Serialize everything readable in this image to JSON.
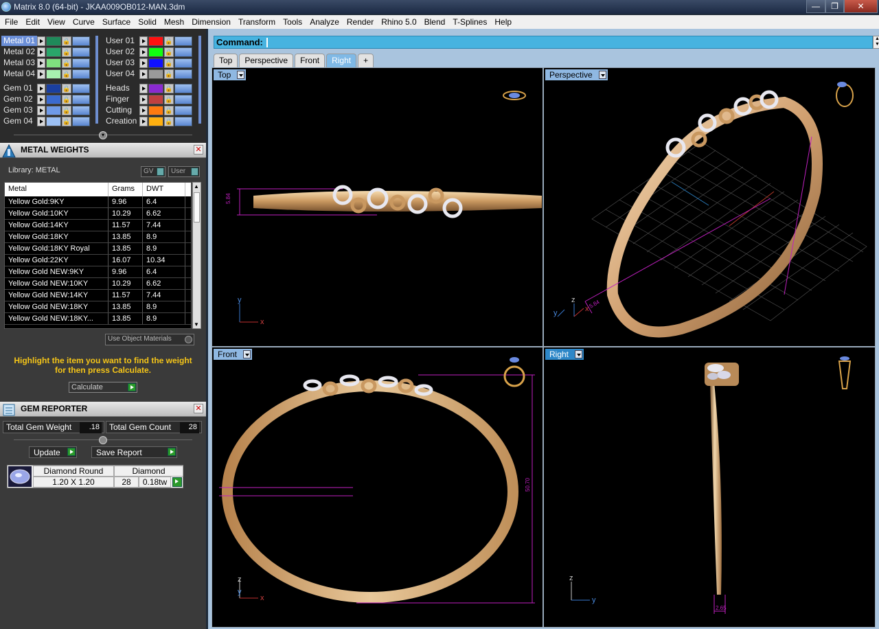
{
  "window": {
    "title": "Matrix 8.0 (64-bit) - JKAA009OB012-MAN.3dm",
    "minimize": "—",
    "restore": "❐",
    "close": "✕"
  },
  "menu": [
    "File",
    "Edit",
    "View",
    "Curve",
    "Surface",
    "Solid",
    "Mesh",
    "Dimension",
    "Transform",
    "Tools",
    "Analyze",
    "Render",
    "Rhino 5.0",
    "Blend",
    "T-Splines",
    "Help"
  ],
  "layers": {
    "left": [
      {
        "name": "Metal 01",
        "color": "#1f8a5a",
        "selected": true
      },
      {
        "name": "Metal 02",
        "color": "#2aa66a"
      },
      {
        "name": "Metal 03",
        "color": "#7fe07f"
      },
      {
        "name": "Metal 04",
        "color": "#a8f0b0"
      },
      {
        "name": "Gem 01",
        "color": "#1a3fa0"
      },
      {
        "name": "Gem 02",
        "color": "#3a6ad0"
      },
      {
        "name": "Gem 03",
        "color": "#6f9ae8"
      },
      {
        "name": "Gem 04",
        "color": "#9cc0f4"
      }
    ],
    "right": [
      {
        "name": "User 01",
        "color": "#ff1010"
      },
      {
        "name": "User 02",
        "color": "#10ff10"
      },
      {
        "name": "User 03",
        "color": "#1010ff"
      },
      {
        "name": "User 04",
        "color": "#9a9a9a"
      },
      {
        "name": "Heads",
        "color": "#8a2ad0"
      },
      {
        "name": "Finger",
        "color": "#c04040"
      },
      {
        "name": "Cutting",
        "color": "#ff7a10"
      },
      {
        "name": "Creation",
        "color": "#ffb010"
      }
    ]
  },
  "metal_weights": {
    "title": "METAL WEIGHTS",
    "library": "Library: METAL",
    "gv_label": "GV",
    "user_label": "User",
    "columns": [
      "Metal",
      "Grams",
      "DWT"
    ],
    "rows": [
      [
        "Yellow Gold:9KY",
        "9.96",
        "6.4"
      ],
      [
        "Yellow Gold:10KY",
        "10.29",
        "6.62"
      ],
      [
        "Yellow Gold:14KY",
        "11.57",
        "7.44"
      ],
      [
        "Yellow Gold:18KY",
        "13.85",
        "8.9"
      ],
      [
        "Yellow Gold:18KY Royal",
        "13.85",
        "8.9"
      ],
      [
        "Yellow Gold:22KY",
        "16.07",
        "10.34"
      ],
      [
        "Yellow Gold NEW:9KY",
        "9.96",
        "6.4"
      ],
      [
        "Yellow Gold NEW:10KY",
        "10.29",
        "6.62"
      ],
      [
        "Yellow Gold NEW:14KY",
        "11.57",
        "7.44"
      ],
      [
        "Yellow Gold NEW:18KY",
        "13.85",
        "8.9"
      ],
      [
        "Yellow Gold NEW:18KY...",
        "13.85",
        "8.9"
      ]
    ],
    "use_object_materials": "Use Object Materials",
    "hint": "Highlight the item you want to find the weight for then press Calculate.",
    "calculate": "Calculate"
  },
  "gem_reporter": {
    "title": "GEM REPORTER",
    "total_weight_label": "Total Gem Weight",
    "total_weight": ".18",
    "total_count_label": "Total Gem Count",
    "total_count": "28",
    "update": "Update",
    "save_report": "Save Report",
    "gem": {
      "shape": "Diamond Round",
      "type": "Diamond",
      "size": "1.20 X 1.20",
      "count": "28",
      "weight": "0.18tw"
    }
  },
  "command": {
    "label": "Command:"
  },
  "view_tabs": [
    "Top",
    "Perspective",
    "Front",
    "Right",
    "+"
  ],
  "active_tab": "Right",
  "viewports": {
    "top": {
      "label": "Top",
      "dim": "5.84"
    },
    "perspective": {
      "label": "Perspective",
      "dim": "5.84"
    },
    "front": {
      "label": "Front",
      "dim": "50.70"
    },
    "right": {
      "label": "Right",
      "dim": "2.65"
    }
  },
  "axes": {
    "x": "x",
    "y": "y",
    "z": "z"
  },
  "colors": {
    "accent": "#2d87c8",
    "command_bar": "#47b3e0",
    "gold": "#d8b07a",
    "dimension": "#c020c0",
    "hint_text": "#f5c518"
  }
}
